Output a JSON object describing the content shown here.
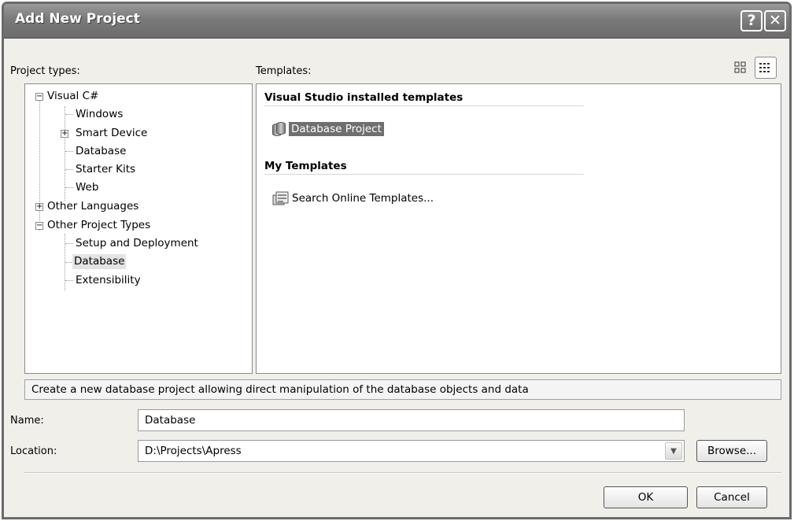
{
  "window": {
    "title": "Add New Project",
    "help_glyph": "?",
    "close_glyph": "✕"
  },
  "labels": {
    "project_types": "Project types:",
    "templates": "Templates:",
    "name": "Name:",
    "location": "Location:"
  },
  "project_tree": [
    {
      "label": "Visual C#",
      "expander": "−",
      "level": 0
    },
    {
      "label": "Windows",
      "level": 1
    },
    {
      "label": "Smart Device",
      "expander": "+",
      "level": 1
    },
    {
      "label": "Database",
      "level": 1
    },
    {
      "label": "Starter Kits",
      "level": 1
    },
    {
      "label": "Web",
      "level": 1
    },
    {
      "label": "Other Languages",
      "expander": "+",
      "level": 0
    },
    {
      "label": "Other Project Types",
      "expander": "−",
      "level": 0
    },
    {
      "label": "Setup and Deployment",
      "level": 1
    },
    {
      "label": "Database",
      "level": 1,
      "selected": true
    },
    {
      "label": "Extensibility",
      "level": 1
    }
  ],
  "templates": {
    "installed_heading": "Visual Studio installed templates",
    "installed_items": [
      {
        "label": "Database Project",
        "icon": "database-icon",
        "selected": true
      }
    ],
    "my_heading": "My Templates",
    "my_items": [
      {
        "label": "Search Online Templates...",
        "icon": "search-online-icon"
      }
    ]
  },
  "description": "Create a new database project allowing direct manipulation of the database objects and data",
  "fields": {
    "name_value": "Database",
    "location_value": "D:\\Projects\\Apress"
  },
  "buttons": {
    "browse": "Browse...",
    "ok": "OK",
    "cancel": "Cancel"
  },
  "colors": {
    "titlebar": "#7a7a7a",
    "dialog_bg": "#f0efea",
    "selection": "#6f6f6f"
  }
}
